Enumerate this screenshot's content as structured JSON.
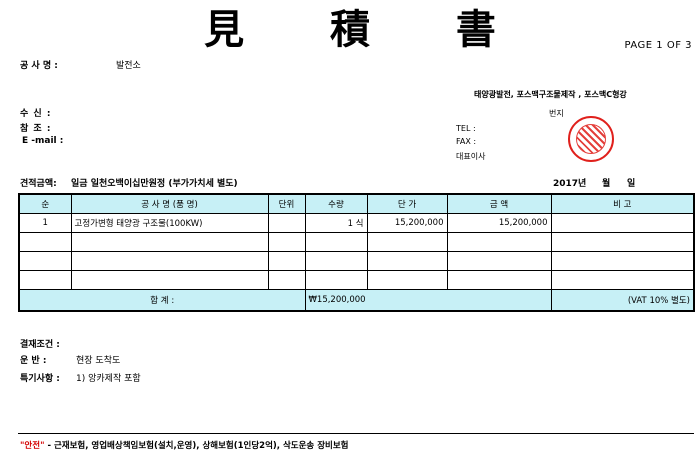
{
  "header": {
    "title": "見 積 書",
    "page_label": "PAGE  1  OF  3"
  },
  "project": {
    "label": "공 사 명 :",
    "value": "발전소"
  },
  "supplier": {
    "company_line": "태양광발전, 포스맥구조물제작 , 포스맥C형강",
    "address_suffix": "번지",
    "tel_label": "TEL :",
    "fax_label": "FAX :",
    "ceo_label": "대표이사"
  },
  "recipient": {
    "to_label": "수    신 :",
    "ref_label": "참    조 :",
    "email_label": "E -mail :"
  },
  "amount": {
    "label": "견적금액:",
    "text": "일금 일천오백이십만원정 (부가가치세 별도)",
    "date_year": "2017년",
    "date_month": "월",
    "date_day": "일"
  },
  "table": {
    "headers": [
      "순",
      "공 사 명 (품 명)",
      "단위",
      "수량",
      "단   가",
      "금     액",
      "비   고"
    ],
    "rows": [
      {
        "no": "1",
        "name": "고정가변형 태양광 구조물(100KW)",
        "unit": "",
        "qty": "1 식",
        "price": "15,200,000",
        "amount": "15,200,000",
        "note": ""
      },
      {
        "no": "",
        "name": "",
        "unit": "",
        "qty": "",
        "price": "",
        "amount": "",
        "note": ""
      },
      {
        "no": "",
        "name": "",
        "unit": "",
        "qty": "",
        "price": "",
        "amount": "",
        "note": ""
      },
      {
        "no": "",
        "name": "",
        "unit": "",
        "qty": "",
        "price": "",
        "amount": "",
        "note": ""
      }
    ],
    "total_label": "합       계 :",
    "total_value": "₩15,200,000",
    "vat_note": "(VAT 10% 별도)"
  },
  "terms": {
    "payment_label": "결재조건 :",
    "delivery_label": "운     반 :",
    "delivery_value": "현장 도착도",
    "special_label": "특기사항 :",
    "special_value": "1) 앙카제작 포함"
  },
  "notice": {
    "highlight": "\"안전\"",
    "text": " - 근재보험, 영업배상책임보험(설치,운영), 상해보험(1인당2억), 삭도운송 장비보험"
  },
  "colors": {
    "table_header_bg": "#c7f0f6",
    "stamp_red": "#e0201c",
    "notice_red": "#d40000"
  },
  "stamp_icon": "company-seal-icon"
}
